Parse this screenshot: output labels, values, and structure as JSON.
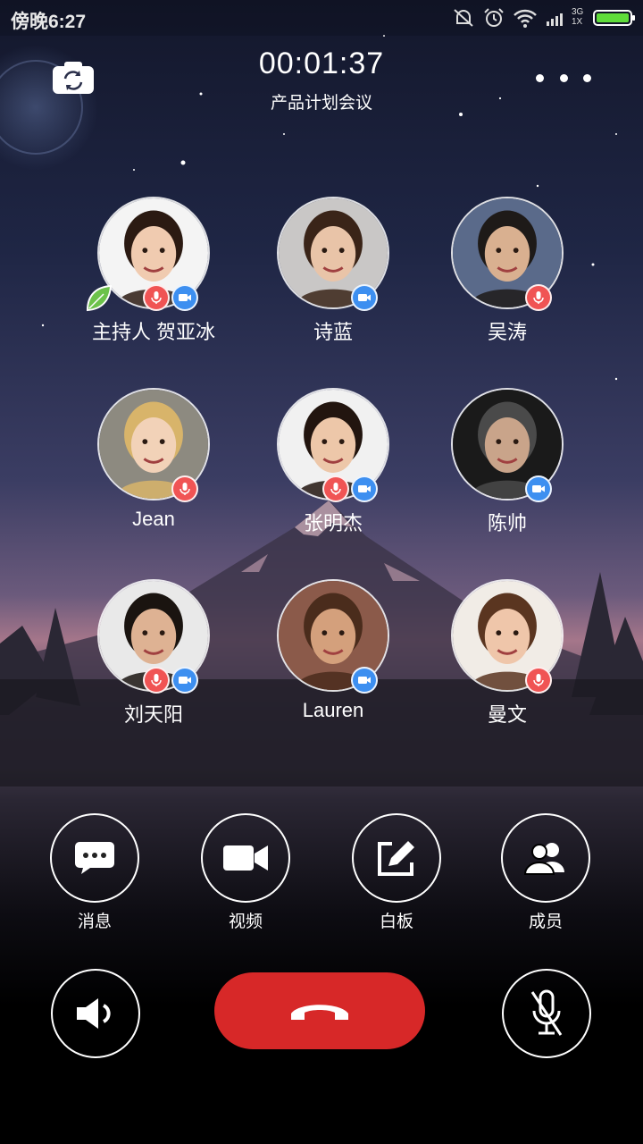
{
  "status_bar": {
    "time": "傍晚6:27",
    "network": "3G 1X",
    "battery_level": 1.0,
    "battery_color": "#5fdc3a"
  },
  "header": {
    "timer": "00:01:37",
    "title": "产品计划会议",
    "switch_camera_icon": "camera-switch-icon",
    "more_icon": "more-dots-icon"
  },
  "participants": [
    {
      "name": "主持人 贺亚冰",
      "host": true,
      "mic_on": true,
      "camera_on": true,
      "host_icon": "leaf-icon"
    },
    {
      "name": "诗蓝",
      "host": false,
      "mic_on": false,
      "camera_on": true
    },
    {
      "name": "吴涛",
      "host": false,
      "mic_on": true,
      "camera_on": false
    },
    {
      "name": "Jean",
      "host": false,
      "mic_on": true,
      "camera_on": false
    },
    {
      "name": "张明杰",
      "host": false,
      "mic_on": true,
      "camera_on": true
    },
    {
      "name": "陈帅",
      "host": false,
      "mic_on": false,
      "camera_on": true
    },
    {
      "name": "刘天阳",
      "host": false,
      "mic_on": true,
      "camera_on": true
    },
    {
      "name": "Lauren",
      "host": false,
      "mic_on": false,
      "camera_on": true
    },
    {
      "name": "曼文",
      "host": false,
      "mic_on": true,
      "camera_on": false
    }
  ],
  "actions": [
    {
      "label": "消息",
      "icon": "chat-bubble-icon"
    },
    {
      "label": "视频",
      "icon": "video-camera-icon"
    },
    {
      "label": "白板",
      "icon": "whiteboard-pen-icon"
    },
    {
      "label": "成员",
      "icon": "members-icon"
    }
  ],
  "controls": {
    "speaker_icon": "speaker-icon",
    "hangup_icon": "phone-hangup-icon",
    "mute_icon": "mic-muted-icon"
  },
  "colors": {
    "mic_badge": "#f05454",
    "camera_badge": "#3d8ff0",
    "hangup": "#d72828"
  }
}
